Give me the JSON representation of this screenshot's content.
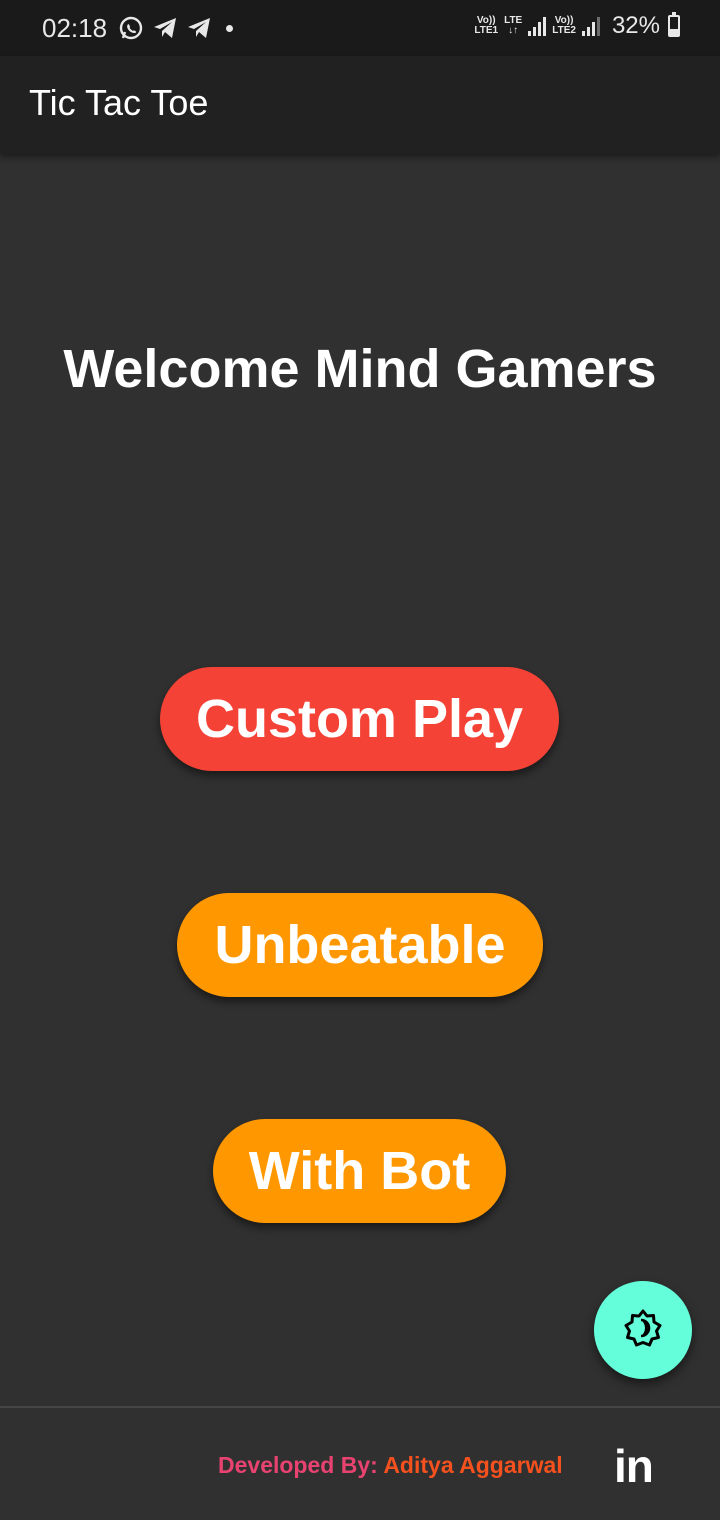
{
  "status_bar": {
    "time": "02:18",
    "sim1_label_top": "Vo))",
    "sim1_label_bottom": "LTE1",
    "lte_label": "LTE",
    "sim2_label_top": "Vo))",
    "sim2_label_bottom": "LTE2",
    "battery_percent": "32%",
    "icons": [
      "whatsapp-icon",
      "telegram-icon",
      "telegram-icon",
      "notification-dot",
      "signal-icon",
      "signal-icon",
      "battery-icon"
    ]
  },
  "app_bar": {
    "title": "Tic Tac Toe"
  },
  "main": {
    "welcome_text": "Welcome Mind Gamers",
    "buttons": [
      {
        "label": "Custom Play",
        "color": "#f44336"
      },
      {
        "label": "Unbeatable",
        "color": "#ff9800"
      },
      {
        "label": "With Bot",
        "color": "#ff9800"
      }
    ]
  },
  "fab": {
    "icon": "brightness-theme-icon",
    "color": "#64ffda"
  },
  "footer": {
    "developed_by_label": "Developed By:",
    "developer_name": "Aditya Aggarwal",
    "linkedin_label": "in"
  },
  "colors": {
    "background": "#303030",
    "app_bar": "#212121",
    "status_bar": "#1a1a1a",
    "accent_red": "#f44336",
    "accent_orange": "#ff9800",
    "fab": "#64ffda",
    "dev_prefix": "#e84370",
    "dev_name": "#f4511e"
  }
}
